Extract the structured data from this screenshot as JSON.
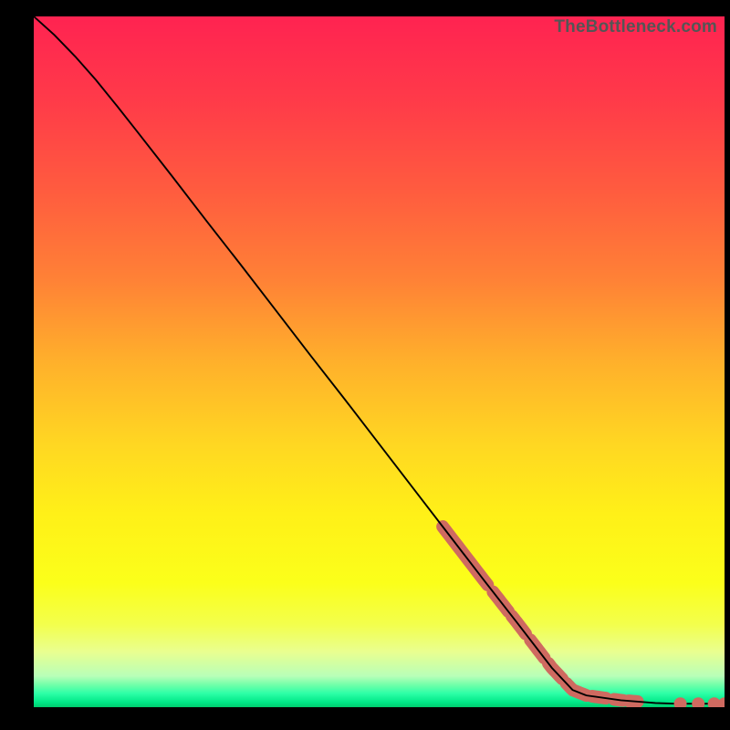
{
  "watermark": "TheBottleneck.com",
  "chart_data": {
    "type": "line",
    "title": "",
    "xlabel": "",
    "ylabel": "",
    "x_range": [
      0,
      100
    ],
    "y_range": [
      0,
      100
    ],
    "curve": [
      {
        "x": 0,
        "y": 100.0
      },
      {
        "x": 3,
        "y": 97.3
      },
      {
        "x": 6,
        "y": 94.2
      },
      {
        "x": 9,
        "y": 90.8
      },
      {
        "x": 12,
        "y": 87.1
      },
      {
        "x": 15,
        "y": 83.3
      },
      {
        "x": 20,
        "y": 76.9
      },
      {
        "x": 25,
        "y": 70.4
      },
      {
        "x": 30,
        "y": 64.0
      },
      {
        "x": 35,
        "y": 57.5
      },
      {
        "x": 40,
        "y": 51.0
      },
      {
        "x": 45,
        "y": 44.6
      },
      {
        "x": 50,
        "y": 38.1
      },
      {
        "x": 55,
        "y": 31.6
      },
      {
        "x": 60,
        "y": 25.1
      },
      {
        "x": 65,
        "y": 18.6
      },
      {
        "x": 70,
        "y": 12.2
      },
      {
        "x": 75,
        "y": 5.7
      },
      {
        "x": 78,
        "y": 2.5
      },
      {
        "x": 80,
        "y": 1.7
      },
      {
        "x": 85,
        "y": 1.0
      },
      {
        "x": 90,
        "y": 0.6
      },
      {
        "x": 93,
        "y": 0.5
      },
      {
        "x": 95,
        "y": 0.5
      },
      {
        "x": 97,
        "y": 0.5
      },
      {
        "x": 100,
        "y": 0.5
      }
    ],
    "marker_segments": [
      {
        "x0": 59.2,
        "x1": 65.7
      },
      {
        "x0": 66.5,
        "x1": 68.7
      },
      {
        "x0": 69.2,
        "x1": 71.2
      },
      {
        "x0": 71.9,
        "x1": 73.9
      },
      {
        "x0": 74.5,
        "x1": 76.5
      },
      {
        "x0": 77.1,
        "x1": 80.0
      },
      {
        "x0": 80.8,
        "x1": 82.8
      },
      {
        "x0": 84.0,
        "x1": 85.3
      },
      {
        "x0": 86.1,
        "x1": 87.4
      }
    ],
    "marker_dots": [
      {
        "x": 93.6,
        "y": 0.5
      },
      {
        "x": 96.2,
        "y": 0.5
      },
      {
        "x": 98.5,
        "y": 0.5
      },
      {
        "x": 100.0,
        "y": 0.5
      }
    ],
    "gradient_stops": [
      {
        "offset": 0.0,
        "color": "#ff2351"
      },
      {
        "offset": 0.12,
        "color": "#ff3a49"
      },
      {
        "offset": 0.25,
        "color": "#ff5b3f"
      },
      {
        "offset": 0.38,
        "color": "#ff8136"
      },
      {
        "offset": 0.5,
        "color": "#ffb02b"
      },
      {
        "offset": 0.62,
        "color": "#ffd722"
      },
      {
        "offset": 0.72,
        "color": "#fff018"
      },
      {
        "offset": 0.82,
        "color": "#fbff1a"
      },
      {
        "offset": 0.88,
        "color": "#f3ff4c"
      },
      {
        "offset": 0.92,
        "color": "#e9ff90"
      },
      {
        "offset": 0.955,
        "color": "#b8ffb8"
      },
      {
        "offset": 0.968,
        "color": "#6fffa9"
      },
      {
        "offset": 0.98,
        "color": "#2dffa7"
      },
      {
        "offset": 0.993,
        "color": "#00e887"
      },
      {
        "offset": 1.0,
        "color": "#00cc6e"
      }
    ],
    "marker_color": "#cf6a60",
    "curve_color": "#000000"
  }
}
